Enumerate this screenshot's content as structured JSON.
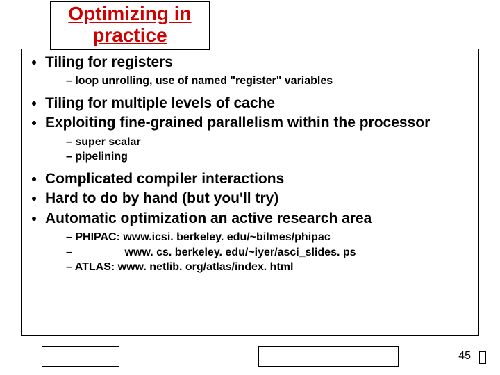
{
  "title": "Optimizing in practice",
  "bullets": {
    "b1": "Tiling for registers",
    "b1_sub1": "loop unrolling, use of named \"register\" variables",
    "b2": "Tiling for multiple levels of cache",
    "b3": "Exploiting fine-grained parallelism within the processor",
    "b3_sub1": "super scalar",
    "b3_sub2": "pipelining",
    "b4": "Complicated compiler interactions",
    "b5": "Hard to do by hand (but you'll try)",
    "b6": "Automatic optimization an active research area",
    "b6_sub1": "PHIPAC: www.icsi. berkeley. edu/~bilmes/phipac",
    "b6_sub2": "                www. cs. berkeley. edu/~iyer/asci_slides. ps",
    "b6_sub3": "ATLAS: www. netlib. org/atlas/index. html"
  },
  "page_number": "45"
}
